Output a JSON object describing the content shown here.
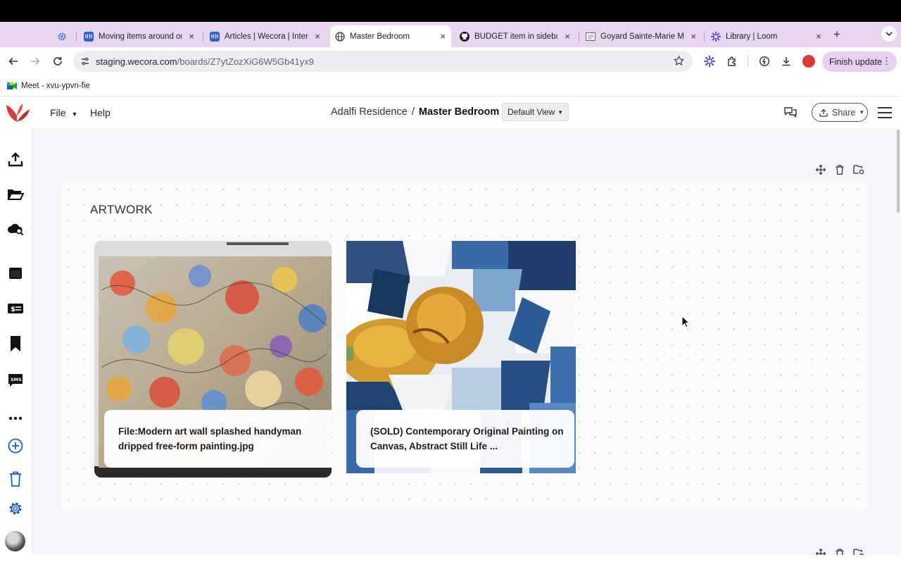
{
  "browser": {
    "tabs": [
      {
        "title": "",
        "favicon": "gear-icon"
      },
      {
        "title": "Moving items around on",
        "favicon": "intercom-icon"
      },
      {
        "title": "Articles | Wecora | Inter",
        "favicon": "intercom-icon"
      },
      {
        "title": "Master Bedroom",
        "favicon": "globe-icon",
        "active": true
      },
      {
        "title": "BUDGET item in sideba",
        "favicon": "github-icon"
      },
      {
        "title": "Goyard Sainte-Marie M",
        "favicon": "page-icon"
      },
      {
        "title": "Library | Loom",
        "favicon": "loom-icon"
      }
    ],
    "close_glyph": "×",
    "new_tab_glyph": "+",
    "url_host": "staging.wecora.com",
    "url_path": "/boards/Z7ytZozXiG6W5Gb41yx9",
    "finish_update_label": "Finish update",
    "bookmarks": [
      {
        "label": "Meet - xvu-ypvn-fie",
        "icon": "meet-icon"
      }
    ]
  },
  "app": {
    "menu": {
      "file_label": "File",
      "help_label": "Help"
    },
    "breadcrumb": {
      "parent": "Adalfi Residence",
      "separator": "/",
      "current": "Master Bedroom"
    },
    "view_select": {
      "value": "Default View"
    },
    "share_label": "Share",
    "board": {
      "title": "ARTWORK",
      "cards": [
        {
          "caption": "File:Modern art wall splashed handyman dripped free-form painting.jpg"
        },
        {
          "caption": "(SOLD) Contemporary Original Painting on Canvas, Abstract Still Life ..."
        }
      ]
    },
    "colors": {
      "brand": "#d93a3a",
      "tabstrip": "#e8d5ef",
      "canvas": "#f4f5f8"
    }
  }
}
